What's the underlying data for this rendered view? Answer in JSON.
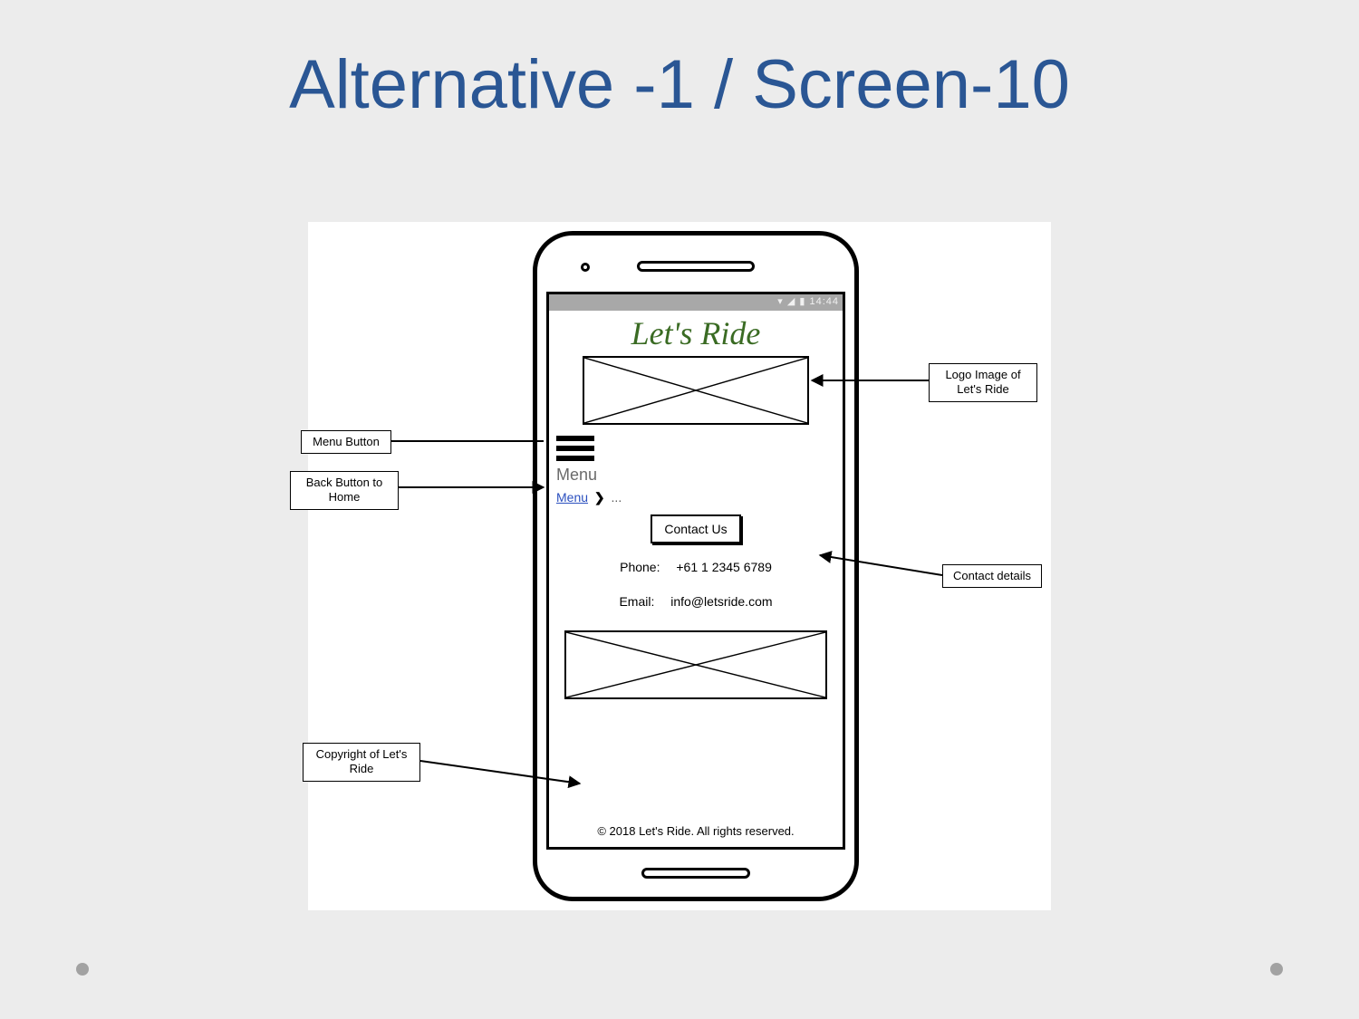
{
  "slide": {
    "title": "Alternative -1 / Screen-10"
  },
  "statusbar": {
    "time": "14:44"
  },
  "app": {
    "title": "Let's Ride",
    "menu_label": "Menu",
    "breadcrumb_link": "Menu",
    "breadcrumb_sep": "❯",
    "breadcrumb_rest": "...",
    "contact_button": "Contact Us",
    "phone_label": "Phone:",
    "phone_value": "+61 1 2345 6789",
    "email_label": "Email:",
    "email_value": "info@letsride.com",
    "copyright": "© 2018 Let's Ride. All rights reserved."
  },
  "annotations": {
    "menu_button": "Menu Button",
    "back_button": "Back Button to Home",
    "logo": "Logo Image of Let's Ride",
    "contact_details": "Contact details",
    "copyright": "Copyright of Let's Ride"
  }
}
